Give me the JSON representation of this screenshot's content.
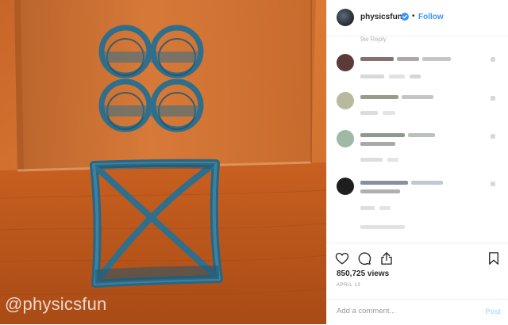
{
  "media": {
    "watermark": "@physicsfun",
    "colors": {
      "wall": "#d3702f",
      "floor": "#c05a1d",
      "plastic": "#2f6f8c"
    }
  },
  "header": {
    "username": "physicsfun",
    "separator": "•",
    "follow_label": "Follow",
    "verified_icon": "verified-badge-icon"
  },
  "comments": {
    "reply_stub": "9w    Reply",
    "items": [
      {
        "avatar_color": "#5c3a3a"
      },
      {
        "avatar_color": "#b9b9a0"
      },
      {
        "avatar_color": "#9fb8a8"
      },
      {
        "avatar_color": "#1e1e1e"
      }
    ]
  },
  "actions": {
    "icons": [
      "heart-icon",
      "comment-icon",
      "share-icon",
      "bookmark-icon"
    ],
    "views": "850,725 views",
    "date": "APRIL 13"
  },
  "comment_box": {
    "placeholder": "Add a comment...",
    "post_label": "Post"
  }
}
